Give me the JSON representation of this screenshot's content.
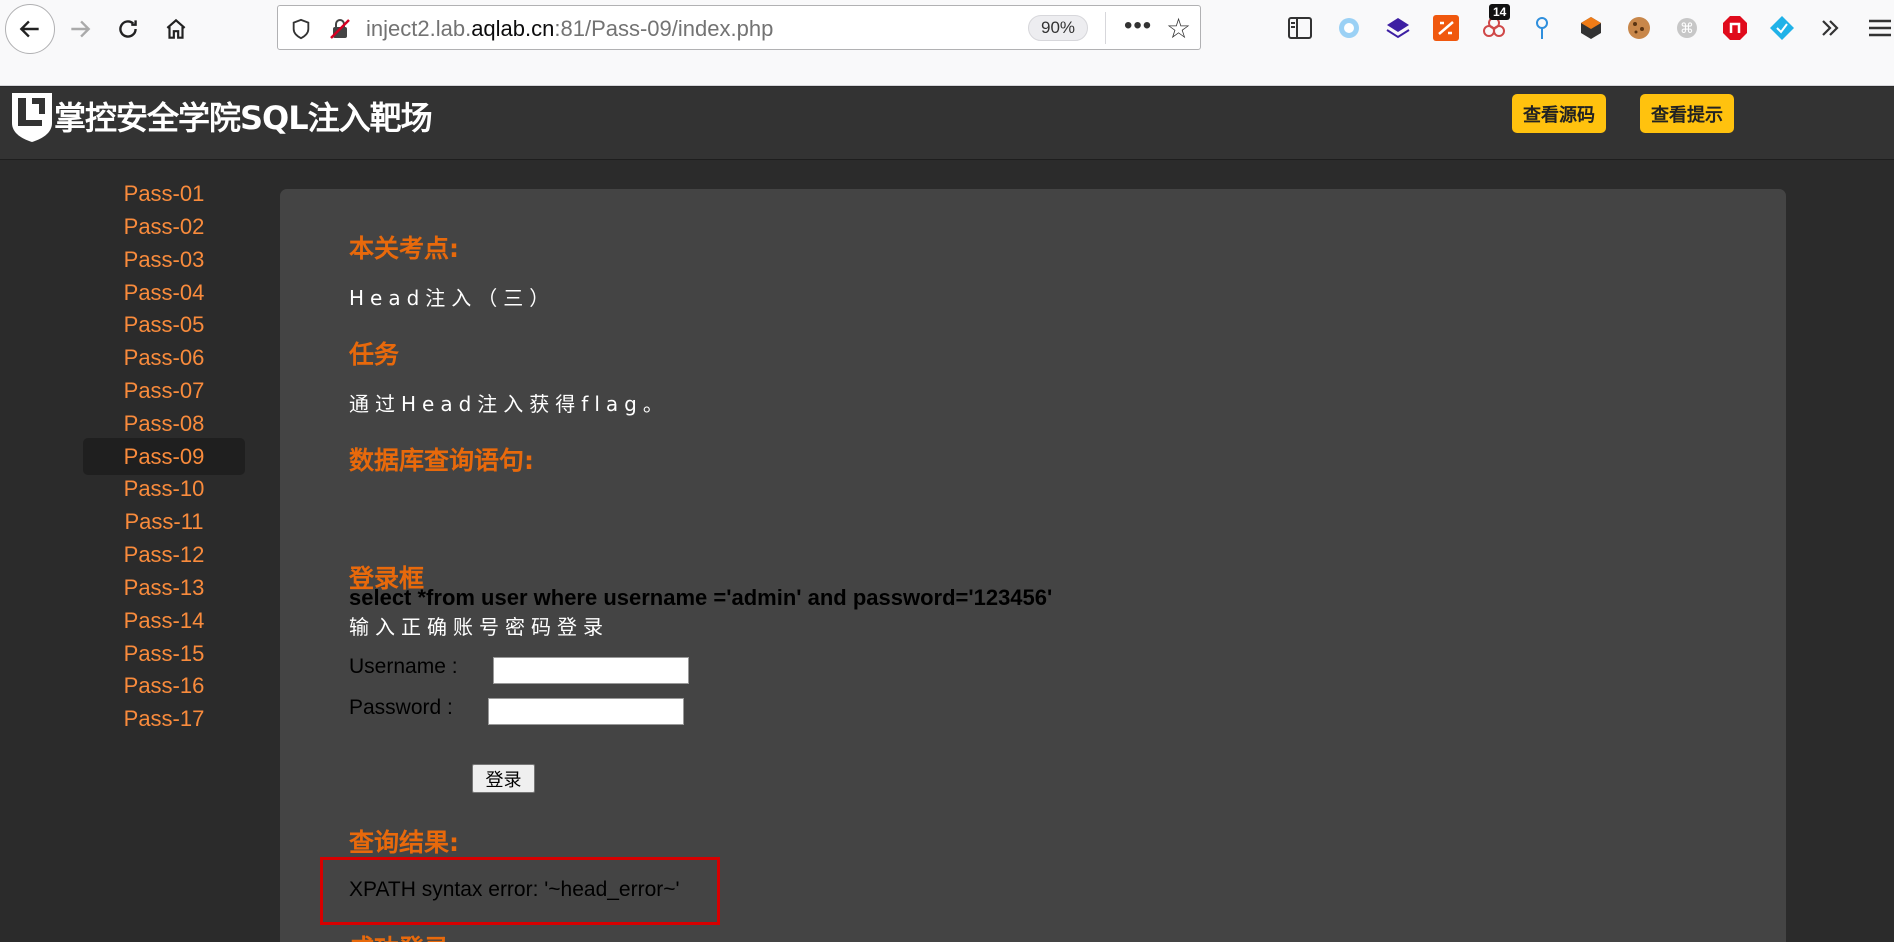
{
  "browser": {
    "url_prefix": "inject2.lab.",
    "url_domain": "aqlab.cn",
    "url_suffix": ":81/Pass-09/index.php",
    "zoom": "90%",
    "ext_badge": "14"
  },
  "site": {
    "title": "掌控安全学院SQL注入靶场",
    "view_source_label": "查看源码",
    "view_hint_label": "查看提示"
  },
  "sidebar": {
    "items": [
      "Pass-01",
      "Pass-02",
      "Pass-03",
      "Pass-04",
      "Pass-05",
      "Pass-06",
      "Pass-07",
      "Pass-08",
      "Pass-09",
      "Pass-10",
      "Pass-11",
      "Pass-12",
      "Pass-13",
      "Pass-14",
      "Pass-15",
      "Pass-16",
      "Pass-17"
    ],
    "active": "Pass-09"
  },
  "content": {
    "topic_heading": "本关考点:",
    "topic_text": "Head注入（三）",
    "task_heading": "任务",
    "task_text": "通过Head注入获得flag。",
    "query_heading": "数据库查询语句:",
    "query_text": "select *from user where username ='admin' and password='123456'",
    "login_heading": "登录框",
    "login_hint": "输入正确账号密码登录",
    "username_label": "Username :",
    "password_label": "Password :",
    "username_value": "",
    "password_value": "",
    "login_button": "登录",
    "result_heading": "查询结果:",
    "result_text": "XPATH syntax error: '~head_error~'",
    "success_heading": "成功登录"
  },
  "colors": {
    "accent": "#e8690b",
    "sidebar_link": "#f98b3c",
    "button_yellow": "#ffc20e",
    "highlight_red": "#d60000"
  }
}
